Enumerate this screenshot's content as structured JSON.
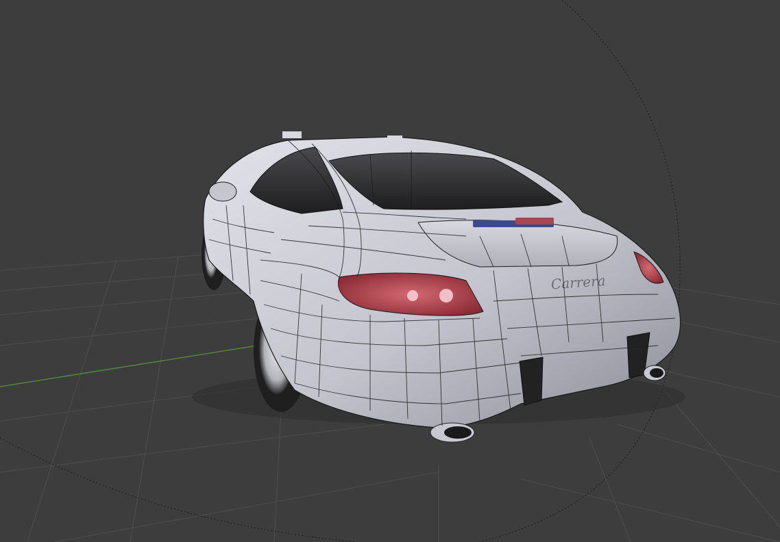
{
  "viewport": {
    "background": "#3d3d3d",
    "grid_color": "#4e4e4e",
    "x_axis_color": "#9a3a3a",
    "y_axis_color": "#4e8a3c",
    "view_circle_color": "#1a1a1a"
  },
  "model": {
    "body_color": "#c9c9d2",
    "wire_color": "#1a1a1a",
    "badge_text": "Carrera",
    "taillight_color": "#b84650",
    "glass_color": "#2a2a2c"
  }
}
